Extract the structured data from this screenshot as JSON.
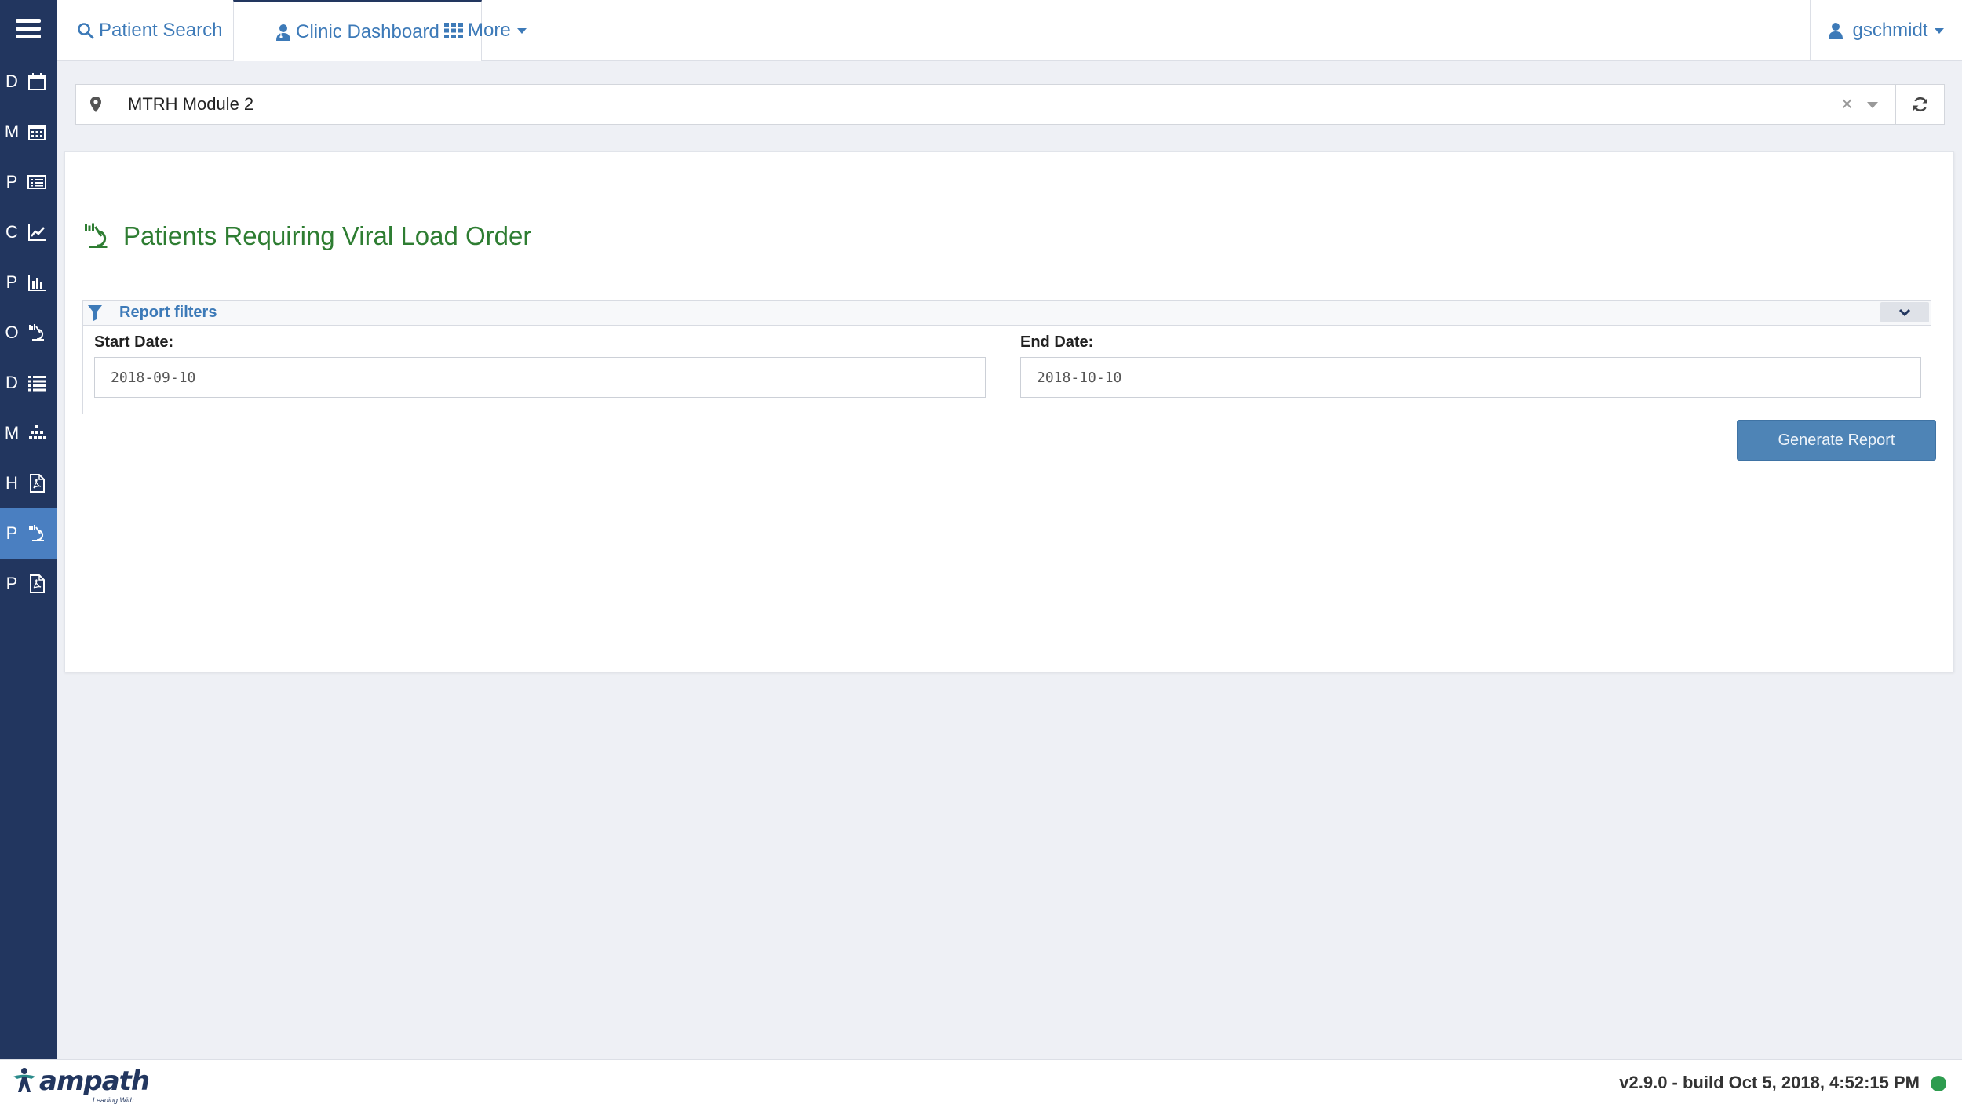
{
  "sidebar": {
    "items": [
      {
        "letter": "D",
        "icon": "calendar-icon"
      },
      {
        "letter": "M",
        "icon": "calendar-grid-icon"
      },
      {
        "letter": "P",
        "icon": "list-card-icon"
      },
      {
        "letter": "C",
        "icon": "line-chart-icon"
      },
      {
        "letter": "P",
        "icon": "bar-chart-icon"
      },
      {
        "letter": "O",
        "icon": "microscope-icon"
      },
      {
        "letter": "D",
        "icon": "list-icon"
      },
      {
        "letter": "M",
        "icon": "sitemap-icon"
      },
      {
        "letter": "H",
        "icon": "pdf-file-icon"
      },
      {
        "letter": "P",
        "icon": "microscope-icon"
      },
      {
        "letter": "P",
        "icon": "pdf-file-icon"
      }
    ],
    "active_index": 9
  },
  "topnav": {
    "patient_search": "Patient Search",
    "clinic_dashboard": "Clinic Dashboard",
    "more": "More",
    "username": "gschmidt"
  },
  "location": {
    "value": "MTRH Module 2"
  },
  "report": {
    "title": "Patients Requiring Viral Load Order",
    "filters_label": "Report filters",
    "start_date_label": "Start Date:",
    "start_date_value": "2018-09-10",
    "end_date_label": "End Date:",
    "end_date_value": "2018-10-10",
    "generate_button": "Generate Report"
  },
  "footer": {
    "logo_text": "ampath",
    "logo_tagline": "Leading With Care",
    "version": "v2.9.0 - build Oct 5, 2018, 4:52:15 PM",
    "status_color": "#2e9c4f"
  },
  "colors": {
    "sidebar": "#22365f",
    "active": "#4a7fc1",
    "link": "#3d7ab8",
    "title_green": "#2e7d32",
    "button": "#4e84b6"
  }
}
